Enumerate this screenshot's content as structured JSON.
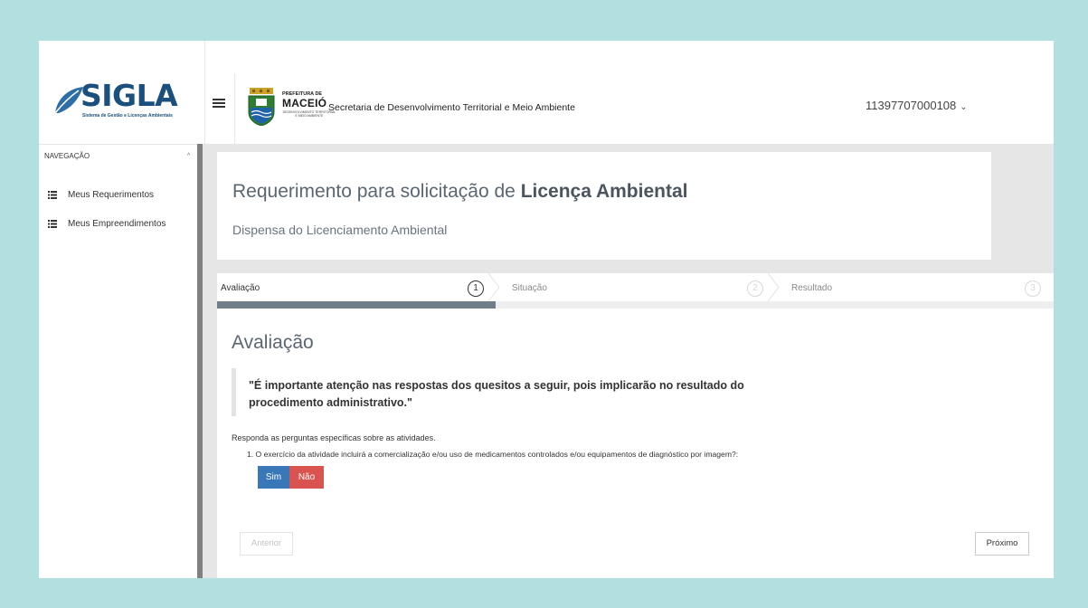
{
  "header": {
    "logo_text": "SIGLA",
    "logo_subtitle": "Sistema de Gestão e Licenças Ambientais",
    "prefeitura_small": "PREFEITURA DE",
    "prefeitura_big": "MACEIÓ",
    "prefeitura_tiny": "DESENVOLVIMENTO TERRITORIAL E MEIO AMBIENTE",
    "secretaria": "Secretaria de Desenvolvimento Territorial e Meio Ambiente",
    "user": "11397707000108",
    "user_chevron": "⌄"
  },
  "sidebar": {
    "nav_header": "NAVEGAÇÃO",
    "nav_caret": "^",
    "items": [
      {
        "label": "Meus Requerimentos",
        "icon": "list-icon"
      },
      {
        "label": "Meus Empreendimentos",
        "icon": "list-icon"
      }
    ]
  },
  "page": {
    "title_prefix": "Requerimento para solicitação de",
    "title_bold": "Licença Ambiental",
    "subtitle": "Dispensa do Licenciamento Ambiental"
  },
  "wizard": {
    "steps": [
      {
        "label": "Avaliação",
        "number": "1",
        "active": true
      },
      {
        "label": "Situação",
        "number": "2",
        "active": false
      },
      {
        "label": "Resultado",
        "number": "3",
        "active": false
      }
    ],
    "progress_fraction": 0.333,
    "section_title": "Avaliação",
    "notice": "\"É importante atenção nas respostas dos quesitos a seguir, pois implicarão no resultado do procedimento administrativo.\"",
    "instruction": "Responda as perguntas específicas sobre as atividades.",
    "question": "1. O exercício da atividade incluirá a comercialização e/ou uso de medicamentos controlados e/ou equipamentos de diagnóstico por imagem?:",
    "yes_label": "Sim",
    "no_label": "Não",
    "prev_label": "Anterior",
    "next_label": "Próximo"
  },
  "colors": {
    "background": "#b2dfe0",
    "brand": "#1b4f7e",
    "progress": "#717d87",
    "yes": "#3a77b8",
    "no": "#d9534f"
  }
}
